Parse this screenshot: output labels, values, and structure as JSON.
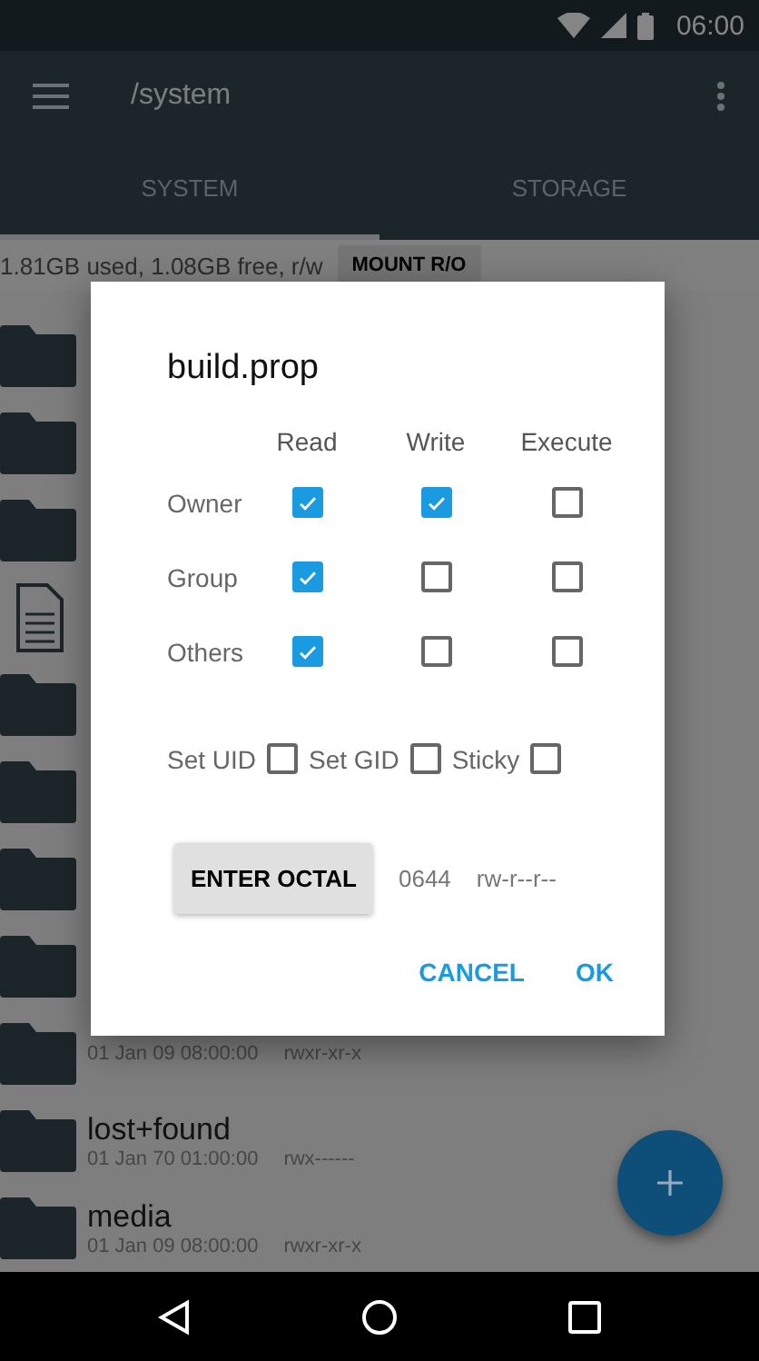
{
  "status_bar": {
    "time": "06:00"
  },
  "app_bar": {
    "path": "/system"
  },
  "tabs": [
    {
      "label": "SYSTEM",
      "selected": true
    },
    {
      "label": "STORAGE",
      "selected": false
    }
  ],
  "storage": {
    "usage": "1.81GB used, 1.08GB free, r/w",
    "mount_button": "MOUNT R/O"
  },
  "files": [
    {
      "kind": "folder"
    },
    {
      "kind": "folder"
    },
    {
      "kind": "folder"
    },
    {
      "kind": "file"
    },
    {
      "kind": "folder"
    },
    {
      "kind": "folder"
    },
    {
      "kind": "folder"
    },
    {
      "kind": "folder"
    },
    {
      "kind": "folder",
      "date": "01 Jan 09 08:00:00",
      "perms": "rwxr-xr-x"
    },
    {
      "kind": "folder",
      "name": "lost+found",
      "date": "01 Jan 70 01:00:00",
      "perms": "rwx------"
    },
    {
      "kind": "folder",
      "name": "media",
      "date": "01 Jan 09 08:00:00",
      "perms": "rwxr-xr-x"
    }
  ],
  "dialog": {
    "title": "build.prop",
    "columns": [
      "Read",
      "Write",
      "Execute"
    ],
    "rows": [
      {
        "label": "Owner",
        "cells": [
          {
            "checked": true
          },
          {
            "checked": true
          },
          {
            "checked": false
          }
        ]
      },
      {
        "label": "Group",
        "cells": [
          {
            "checked": true
          },
          {
            "checked": false
          },
          {
            "checked": false
          }
        ]
      },
      {
        "label": "Others",
        "cells": [
          {
            "checked": true
          },
          {
            "checked": false
          },
          {
            "checked": false
          }
        ]
      }
    ],
    "special": [
      {
        "label": "Set UID",
        "checked": false
      },
      {
        "label": "Set GID",
        "checked": false
      },
      {
        "label": "Sticky",
        "checked": false
      }
    ],
    "octal_button": "ENTER OCTAL",
    "octal": "0644",
    "symbolic": "rw-r--r--",
    "actions": [
      "CANCEL",
      "OK"
    ]
  }
}
